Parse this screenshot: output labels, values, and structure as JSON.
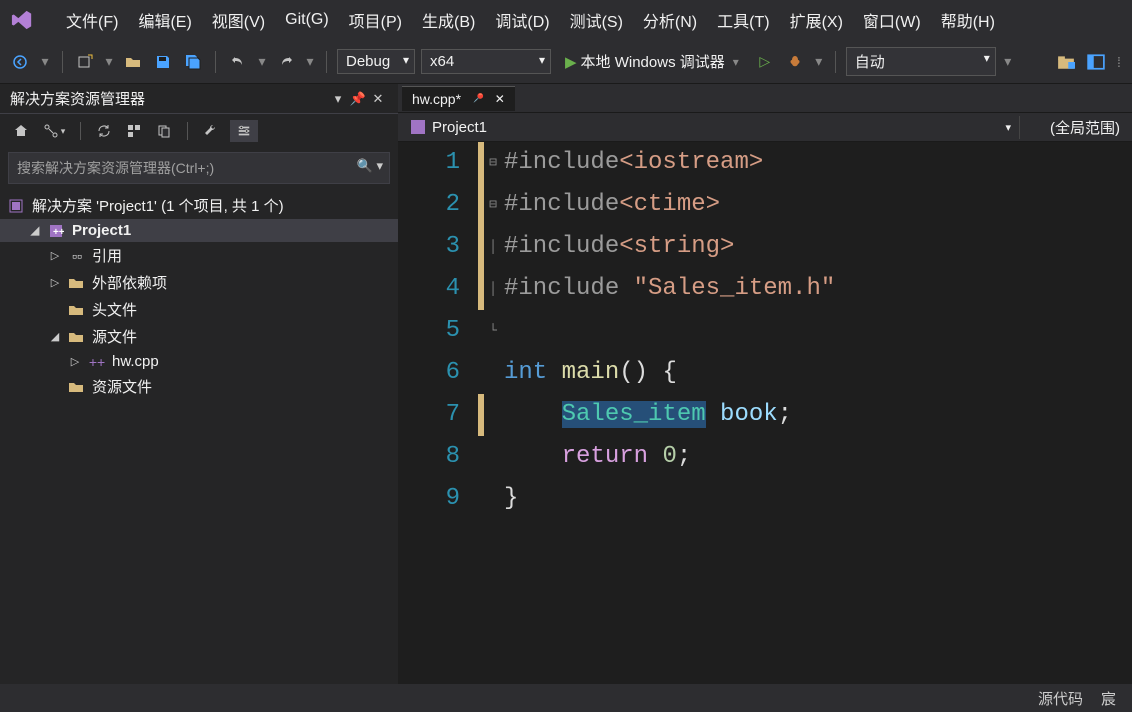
{
  "menu": {
    "file": "文件(F)",
    "edit": "编辑(E)",
    "view": "视图(V)",
    "git": "Git(G)",
    "project": "项目(P)",
    "build": "生成(B)",
    "debug_m": "调试(D)",
    "test": "测试(S)",
    "analyze": "分析(N)",
    "tools": "工具(T)",
    "extensions": "扩展(X)",
    "window": "窗口(W)",
    "help": "帮助(H)"
  },
  "toolbar": {
    "config": "Debug",
    "platform": "x64",
    "run": "本地 Windows 调试器",
    "auto": "自动"
  },
  "sidebar": {
    "title": "解决方案资源管理器",
    "search_placeholder": "搜索解决方案资源管理器(Ctrl+;)",
    "solution": "解决方案 'Project1' (1 个项目, 共 1 个)",
    "project": "Project1",
    "references": "引用",
    "external": "外部依赖项",
    "headers": "头文件",
    "sources": "源文件",
    "file1": "hw.cpp",
    "resources": "资源文件"
  },
  "tabs": {
    "file": "hw.cpp*"
  },
  "context": {
    "project": "Project1",
    "scope": "(全局范围)"
  },
  "code": {
    "lines": [
      "#include<iostream>",
      "#include<ctime>",
      "#include<string>",
      "#include \"Sales_item.h\"",
      "",
      "int main() {",
      "    Sales_item book;",
      "    return 0;",
      "}"
    ]
  },
  "status": {
    "source": "源代码",
    "name": "宸"
  }
}
